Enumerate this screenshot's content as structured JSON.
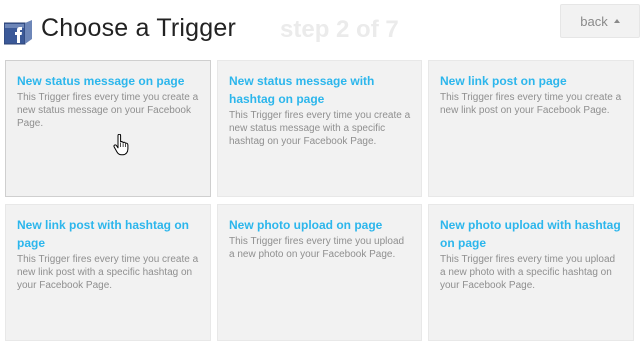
{
  "header": {
    "title": "Choose a Trigger",
    "step": "step 2 of 7",
    "back_label": "back",
    "icon": "facebook-icon"
  },
  "colors": {
    "accent": "#2cb6ec",
    "facebook_blue": "#3b5998",
    "card_bg": "#f2f2f2"
  },
  "triggers": [
    {
      "title": "New status message on page",
      "description": "This Trigger fires every time you create a new status message on your Facebook Page."
    },
    {
      "title": "New status message with hashtag on page",
      "description": "This Trigger fires every time you create a new status message with a specific hashtag on your Facebook Page."
    },
    {
      "title": "New link post on page",
      "description": "This Trigger fires every time you create a new link post on your Facebook Page."
    },
    {
      "title": "New link post with hashtag on page",
      "description": "This Trigger fires every time you create a new link post with a specific hashtag on your Facebook Page."
    },
    {
      "title": "New photo upload on page",
      "description": "This Trigger fires every time you upload a new photo on your Facebook Page."
    },
    {
      "title": "New photo upload with hashtag on page",
      "description": "This Trigger fires every time you upload a new photo with a specific hashtag on your Facebook Page."
    }
  ]
}
